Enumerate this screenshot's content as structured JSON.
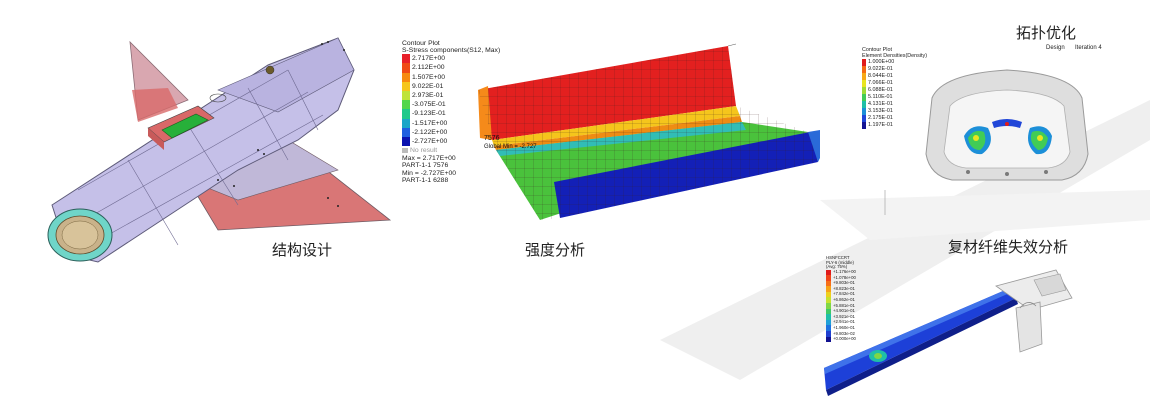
{
  "captions": {
    "structure": "结构设计",
    "strength": "强度分析",
    "topology": "拓扑优化",
    "composite": "复材纤维失效分析"
  },
  "stress_legend": {
    "title": "Contour Plot",
    "subtitle": "S-Stress components(S12, Max)",
    "values": [
      "2.717E+00",
      "2.112E+00",
      "1.507E+00",
      "9.022E-01",
      "2.973E-01",
      "-3.075E-01",
      "-9.123E-01",
      "-1.517E+00",
      "-2.122E+00",
      "-2.727E+00"
    ],
    "colors": [
      "#e8202a",
      "#f04a16",
      "#f78a10",
      "#f6c61c",
      "#bfe33a",
      "#52d64c",
      "#1fc98a",
      "#1aa6c8",
      "#1f5fe0",
      "#0a12b0"
    ],
    "no_result": "No result",
    "max": "Max = 2.717E+00",
    "max_part": "PART-1-1 7576",
    "min": "Min = -2.727E+00",
    "min_part": "PART-1-1 6288"
  },
  "strength_labels": {
    "max_tag": "7576",
    "min_tag": "Global Min = -2.727"
  },
  "topology": {
    "legend_title": "Contour Plot",
    "legend_subtitle": "Element Densities(Density)",
    "values": [
      "1.000E+00",
      "9.022E-01",
      "8.044E-01",
      "7.066E-01",
      "6.088E-01",
      "5.110E-01",
      "4.131E-01",
      "3.153E-01",
      "2.175E-01",
      "1.197E-01"
    ],
    "colors": [
      "#e01b1b",
      "#f46914",
      "#f7a817",
      "#e9e51f",
      "#9fdc35",
      "#41cc56",
      "#1fbfa8",
      "#1c8fd8",
      "#2046d8",
      "#141493"
    ],
    "design_label": "Design",
    "iteration_label": "Iteration 4"
  },
  "composite": {
    "legend_title": "HSNFCCRT",
    "legend_sub1": "PLY-6 (middle)",
    "legend_sub2": "(Avg: 75%)",
    "values": [
      "+1.176e+00",
      "+1.078e+00",
      "+9.803e-01",
      "+8.823e-01",
      "+7.842e-01",
      "+6.862e-01",
      "+5.881e-01",
      "+4.901e-01",
      "+3.921e-01",
      "+2.941e-01",
      "+1.960e-01",
      "+9.803e-02",
      "+0.000e+00"
    ],
    "colors": [
      "#e01b1b",
      "#f0451a",
      "#f76f18",
      "#f7a217",
      "#eed01e",
      "#c6e12e",
      "#7fd746",
      "#3fca66",
      "#1fbfa8",
      "#1ea0d8",
      "#1d72e0",
      "#2040d0",
      "#121290"
    ]
  }
}
